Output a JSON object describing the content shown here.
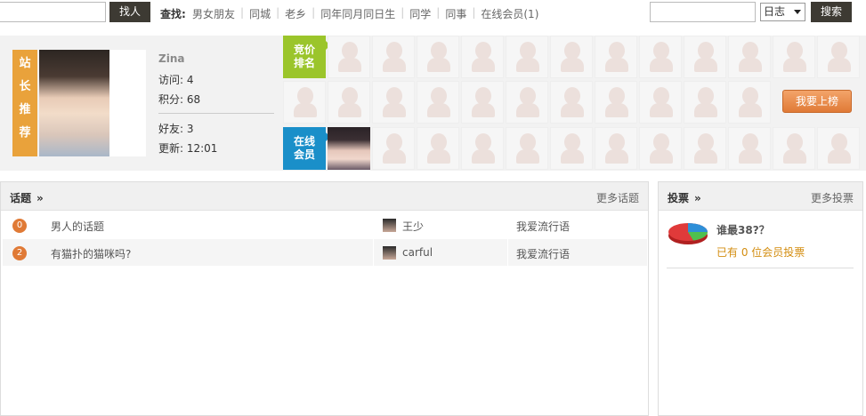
{
  "topbar": {
    "find_button": "找人",
    "search_label": "查找:",
    "links": [
      "男女朋友",
      "同城",
      "老乡",
      "同年同月同日生",
      "同学",
      "同事",
      "在线会员(1)"
    ],
    "type_select": "日志",
    "search_button": "搜索"
  },
  "profile": {
    "ribbon": "站长推荐",
    "name": "Zina",
    "visits": "访问: 4",
    "points": "积分: 68",
    "friends": "好友: 3",
    "updated": "更新: 12:01"
  },
  "grid": {
    "bid_badge": "竞价排名",
    "online_badge": "在线会员",
    "rank_button": "我要上榜"
  },
  "topics": {
    "title": "话题",
    "more": "更多话题",
    "rows": [
      {
        "num": "0",
        "subject": "男人的话题",
        "user": "王少",
        "group": "我爱流行语"
      },
      {
        "num": "2",
        "subject": "有猫扑的猫咪吗?",
        "user": "carful",
        "group": "我爱流行语"
      }
    ]
  },
  "votes": {
    "title": "投票",
    "more": "更多投票",
    "poll_title": "谁最38?？",
    "poll_count": "已有 0 位会员投票"
  },
  "colors": {
    "accent_orange": "#e07a36",
    "dark_button": "#3d3a33",
    "ribbon": "#e9a23b",
    "green_badge": "#9bc52b",
    "blue_badge": "#1a8fc9"
  }
}
